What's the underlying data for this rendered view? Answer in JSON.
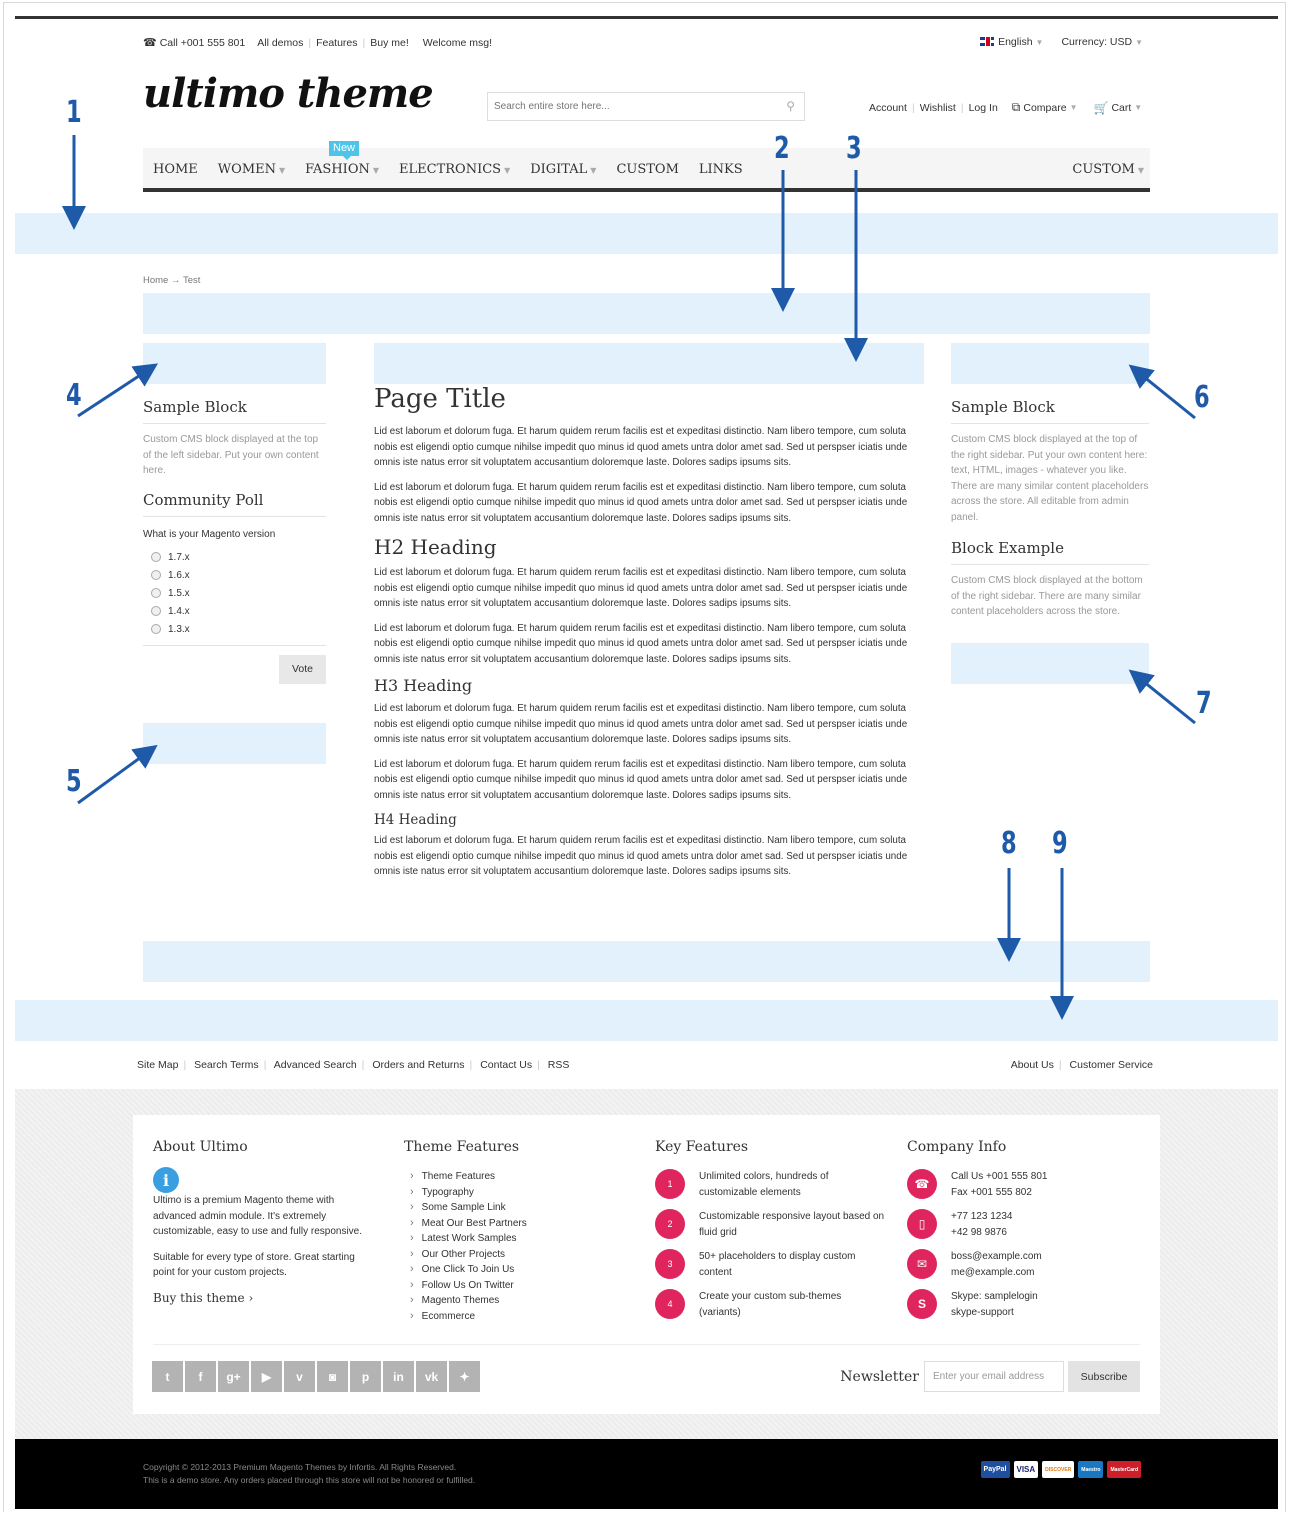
{
  "topbar": {
    "phone": "Call +001 555 801",
    "links": [
      "All demos",
      "Features",
      "Buy me!",
      "Welcome msg!"
    ],
    "language": "English",
    "currency": "Currency: USD"
  },
  "header": {
    "logo": "ultimo theme",
    "search_placeholder": "Search entire store here...",
    "account_links": [
      "Account",
      "Wishlist",
      "Log In"
    ],
    "compare": "Compare",
    "cart": "Cart"
  },
  "nav": {
    "items": [
      "HOME",
      "WOMEN",
      "FASHION",
      "ELECTRONICS",
      "DIGITAL",
      "CUSTOM",
      "LINKS"
    ],
    "right": "CUSTOM",
    "badge": "New"
  },
  "breadcrumb": "Home → Test",
  "left_sidebar": {
    "block_title": "Sample Block",
    "block_text": "Custom CMS block displayed at the top of the left sidebar. Put your own content here.",
    "poll_title": "Community Poll",
    "poll_question": "What is your Magento version",
    "poll_options": [
      "1.7.x",
      "1.6.x",
      "1.5.x",
      "1.4.x",
      "1.3.x"
    ],
    "vote": "Vote"
  },
  "main": {
    "title": "Page Title",
    "h2": "H2 Heading",
    "h3": "H3 Heading",
    "h4": "H4 Heading",
    "para": "Lid est laborum et dolorum fuga. Et harum quidem rerum facilis est et expeditasi distinctio. Nam libero tempore, cum soluta nobis est eligendi optio cumque nihilse impedit quo minus id quod amets untra dolor amet sad. Sed ut perspser iciatis unde omnis iste natus error sit voluptatem accusantium doloremque laste. Dolores sadips ipsums sits."
  },
  "right_sidebar": {
    "block_title": "Sample Block",
    "block_text": "Custom CMS block displayed at the top of the right sidebar. Put your own content here: text, HTML, images - whatever you like. There are many similar content placeholders across the store. All editable from admin panel.",
    "example_title": "Block Example",
    "example_text": "Custom CMS block displayed at the bottom of the right sidebar. There are many similar content placeholders across the store."
  },
  "annotations": [
    "1",
    "2",
    "3",
    "4",
    "5",
    "6",
    "7",
    "8",
    "9"
  ],
  "footer_links": {
    "left": [
      "Site Map",
      "Search Terms",
      "Advanced Search",
      "Orders and Returns",
      "Contact Us",
      "RSS"
    ],
    "right": [
      "About Us",
      "Customer Service"
    ]
  },
  "footer": {
    "about_title": "About Ultimo",
    "about_text1": "Ultimo is a premium Magento theme with advanced admin module. It's extremely customizable, easy to use and fully responsive.",
    "about_text2": "Suitable for every type of store. Great starting point for your custom projects.",
    "buy": "Buy this theme",
    "features_title": "Theme Features",
    "features": [
      "Theme Features",
      "Typography",
      "Some Sample Link",
      "Meat Our Best Partners",
      "Latest Work Samples",
      "Our Other Projects",
      "One Click To Join Us",
      "Follow Us On Twitter",
      "Magento Themes",
      "Ecommerce"
    ],
    "key_title": "Key Features",
    "key": [
      {
        "n": "1",
        "t": "Unlimited colors, hundreds of customizable elements"
      },
      {
        "n": "2",
        "t": "Customizable responsive layout based on fluid grid"
      },
      {
        "n": "3",
        "t": "50+ placeholders to display custom content"
      },
      {
        "n": "4",
        "t": "Create your custom sub-themes (variants)"
      }
    ],
    "company_title": "Company Info",
    "company": [
      {
        "icon": "phone-icon",
        "l1": "Call Us +001 555 801",
        "l2": "Fax +001 555 802"
      },
      {
        "icon": "mobile-icon",
        "l1": "+77 123 1234",
        "l2": "+42 98 9876"
      },
      {
        "icon": "mail-icon",
        "l1": "boss@example.com",
        "l2": "me@example.com"
      },
      {
        "icon": "skype-icon",
        "l1": "Skype: samplelogin",
        "l2": "skype-support"
      }
    ],
    "newsletter": "Newsletter",
    "email_placeholder": "Enter your email address",
    "subscribe": "Subscribe",
    "copyright1": "Copyright © 2012-2013 Premium Magento Themes by Infortis. All Rights Reserved.",
    "copyright2": "This is a demo store. Any orders placed through this store will not be honored or fulfilled.",
    "payments": [
      "PayPal",
      "VISA",
      "DISCOVER",
      "Maestro",
      "MasterCard"
    ]
  },
  "colors": {
    "accent": "#e0245e",
    "placeholder": "#e3f1fd",
    "arrow": "#1f5aa8",
    "badge": "#4fc4e9"
  }
}
